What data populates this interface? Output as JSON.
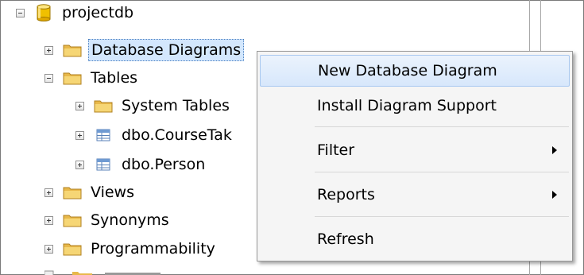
{
  "tree": {
    "root": {
      "label": "projectdb",
      "expanded": true,
      "icon": "database-icon"
    },
    "items": [
      {
        "label": "Database Diagrams",
        "expanded": false,
        "icon": "folder-icon",
        "selected": true
      },
      {
        "label": "Tables",
        "expanded": true,
        "icon": "folder-icon"
      },
      {
        "label": "System Tables",
        "expanded": false,
        "icon": "folder-icon"
      },
      {
        "label": "dbo.CourseTak",
        "expanded": false,
        "icon": "table-icon"
      },
      {
        "label": "dbo.Person",
        "expanded": false,
        "icon": "table-icon"
      },
      {
        "label": "Views",
        "expanded": false,
        "icon": "folder-icon"
      },
      {
        "label": "Synonyms",
        "expanded": false,
        "icon": "folder-icon"
      },
      {
        "label": "Programmability",
        "expanded": false,
        "icon": "folder-icon"
      }
    ]
  },
  "context_menu": {
    "items": [
      {
        "label": "New Database Diagram",
        "highlighted": true
      },
      {
        "label": "Install Diagram Support"
      },
      {
        "label": "Filter",
        "submenu": true
      },
      {
        "label": "Reports",
        "submenu": true
      },
      {
        "label": "Refresh"
      }
    ]
  },
  "colors": {
    "selection": "#d3e7fd",
    "menu_highlight": "#d7e7fb",
    "folder": "#f2c84b",
    "database": "#e8b200"
  }
}
